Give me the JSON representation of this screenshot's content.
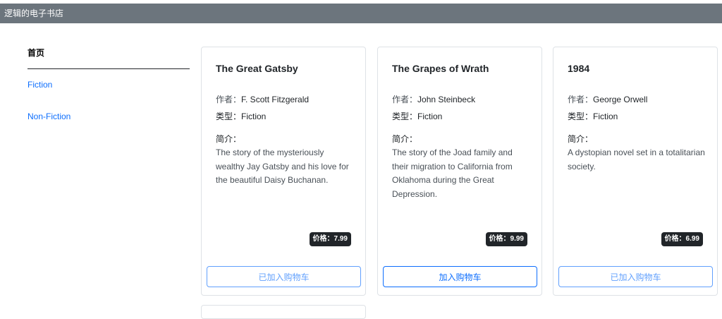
{
  "header": {
    "title": "逻辑的电子书店"
  },
  "sidebar": {
    "home": "首页",
    "items": [
      {
        "label": "Fiction"
      },
      {
        "label": "Non-Fiction"
      }
    ]
  },
  "labels": {
    "author": "作者：",
    "genre": "类型：",
    "desc": "简介："
  },
  "books": [
    {
      "title": "The Great Gatsby",
      "author": "F. Scott Fitzgerald",
      "genre": "Fiction",
      "description": "The story of the mysteriously wealthy Jay Gatsby and his love for the beautiful Daisy Buchanan.",
      "price": "价格：7.99",
      "button": "已加入购物车"
    },
    {
      "title": "The Grapes of Wrath",
      "author": "John Steinbeck",
      "genre": "Fiction",
      "description": "The story of the Joad family and their migration to California from Oklahoma during the Great Depression.",
      "price": "价格：9.99",
      "button": "加入购物车"
    },
    {
      "title": "1984",
      "author": "George Orwell",
      "genre": "Fiction",
      "description": "A dystopian novel set in a totalitarian society.",
      "price": "价格：6.99",
      "button": "已加入购物车"
    }
  ]
}
